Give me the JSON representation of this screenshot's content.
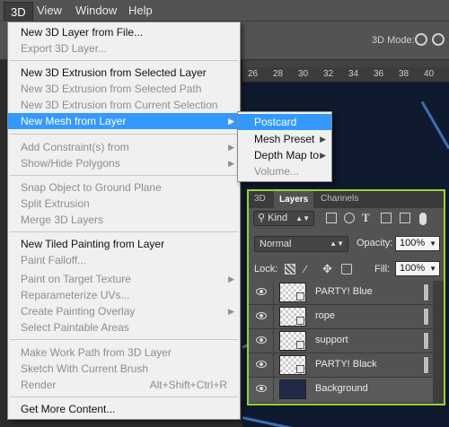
{
  "menubar": {
    "items": [
      "3D",
      "View",
      "Window",
      "Help"
    ]
  },
  "options_bar": {
    "mode_label": "3D Mode:"
  },
  "ruler": {
    "numbers": [
      "26",
      "28",
      "30",
      "32",
      "34",
      "36",
      "38",
      "40"
    ]
  },
  "menu": {
    "items": [
      {
        "label": "New 3D Layer from File...",
        "state": "enabled"
      },
      {
        "label": "Export 3D Layer...",
        "state": "disabled"
      },
      {
        "label": "New 3D Extrusion from Selected Layer",
        "state": "enabled"
      },
      {
        "label": "New 3D Extrusion from Selected Path",
        "state": "disabled"
      },
      {
        "label": "New 3D Extrusion from Current Selection",
        "state": "disabled"
      },
      {
        "label": "New Mesh from Layer",
        "state": "selected"
      },
      {
        "label": "Add Constraint(s) from",
        "state": "disabled"
      },
      {
        "label": "Show/Hide Polygons",
        "state": "disabled"
      },
      {
        "label": "Snap Object to Ground Plane",
        "state": "disabled"
      },
      {
        "label": "Split Extrusion",
        "state": "disabled"
      },
      {
        "label": "Merge 3D Layers",
        "state": "disabled"
      },
      {
        "label": "New Tiled Painting from Layer",
        "state": "enabled"
      },
      {
        "label": "Paint Falloff...",
        "state": "disabled"
      },
      {
        "label": "Paint on Target Texture",
        "state": "disabled"
      },
      {
        "label": "Reparameterize UVs...",
        "state": "disabled"
      },
      {
        "label": "Create Painting Overlay",
        "state": "disabled"
      },
      {
        "label": "Select Paintable Areas",
        "state": "disabled"
      },
      {
        "label": "Make Work Path from 3D Layer",
        "state": "disabled"
      },
      {
        "label": "Sketch With Current Brush",
        "state": "disabled"
      },
      {
        "label": "Render",
        "state": "disabled",
        "shortcut": "Alt+Shift+Ctrl+R"
      },
      {
        "label": "Get More Content...",
        "state": "enabled"
      }
    ]
  },
  "submenu": {
    "items": [
      {
        "label": "Postcard",
        "state": "selected"
      },
      {
        "label": "Mesh Preset",
        "state": "enabled"
      },
      {
        "label": "Depth Map to",
        "state": "enabled"
      },
      {
        "label": "Volume...",
        "state": "disabled"
      }
    ]
  },
  "layers_panel": {
    "tabs": [
      "3D",
      "Layers",
      "Channels"
    ],
    "active_tab": "Layers",
    "filter_kind": "Kind",
    "blend_mode": "Normal",
    "opacity_label": "Opacity:",
    "opacity": "100%",
    "lock_label": "Lock:",
    "fill_label": "Fill:",
    "fill": "100%",
    "layers": [
      {
        "name": "PARTY! Blue"
      },
      {
        "name": "rope"
      },
      {
        "name": "support"
      },
      {
        "name": "PARTY! Black"
      },
      {
        "name": "Background"
      }
    ]
  },
  "colors": {
    "selection": "#3399ff",
    "panel_highlight": "#9bd135",
    "menu_bg": "#f0f0f0"
  }
}
